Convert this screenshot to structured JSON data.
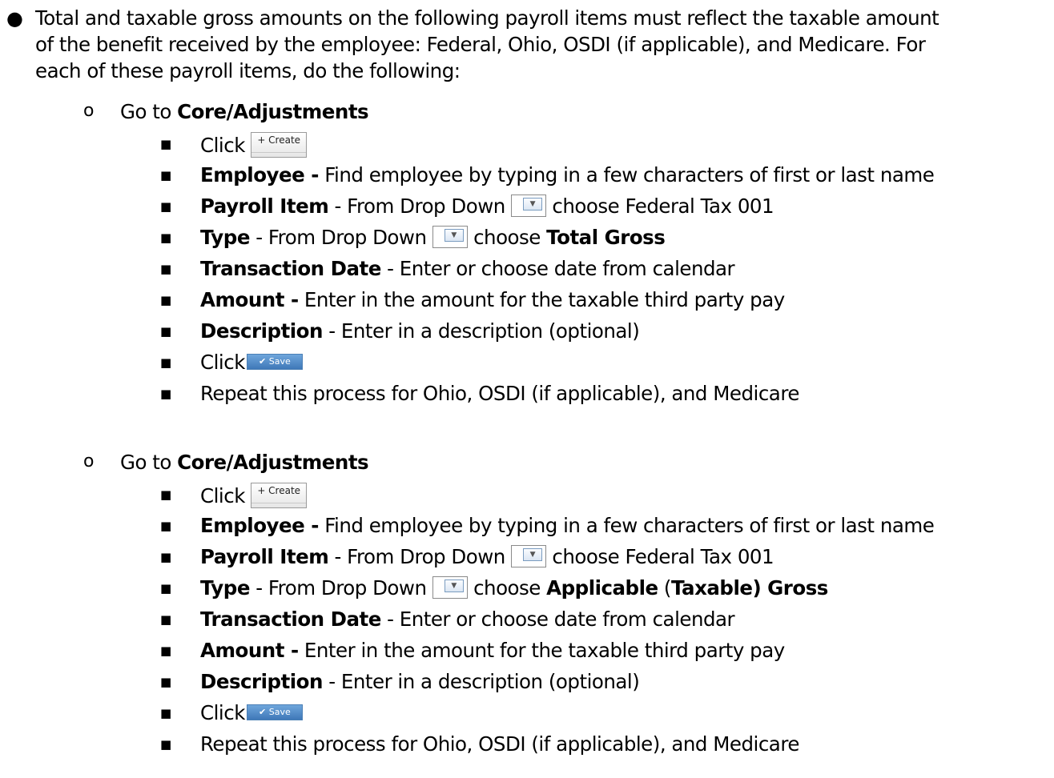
{
  "intro": {
    "line1": "Total and taxable gross amounts on the following payroll items must reflect the taxable amount",
    "line2": "of the benefit received by the employee: Federal, Ohio, OSDI (if applicable), and Medicare. For",
    "line3": "each of these payroll items, do the following:"
  },
  "sections": [
    {
      "goto_prefix": "Go to ",
      "goto_bold": "Core/Adjustments",
      "click1": "Click",
      "create_label": "+ Create",
      "employee_label": "Employee -",
      "employee_text": " Find employee by typing in a few characters of first or last name",
      "payroll_label": "Payroll Item",
      "payroll_prefix": " - From Drop Down ",
      "payroll_suffix": " choose Federal Tax 001",
      "type_label": "Type",
      "type_prefix": " - From Drop Down ",
      "type_mid": " choose ",
      "type_choice_bold_1": "Total Gross",
      "type_choice_plain": "",
      "type_choice_bold_2": "",
      "tdate_label": "Transaction Date",
      "tdate_text": " - Enter or choose date from calendar",
      "amount_label": "Amount -",
      "amount_text": " Enter in the amount for the taxable third party pay",
      "desc_label": "Description",
      "desc_text": " - Enter in a description (optional)",
      "click2": "Click",
      "save_label": "✔ Save",
      "repeat_text": "Repeat this process for Ohio, OSDI (if applicable), and Medicare"
    },
    {
      "goto_prefix": "Go to ",
      "goto_bold": "Core/Adjustments",
      "click1": "Click",
      "create_label": "+ Create",
      "employee_label": "Employee -",
      "employee_text": " Find employee by typing in a few characters of first or last name",
      "payroll_label": "Payroll Item",
      "payroll_prefix": " - From Drop Down ",
      "payroll_suffix": " choose Federal Tax 001",
      "type_label": "Type",
      "type_prefix": " - From Drop Down ",
      "type_mid": " choose ",
      "type_choice_bold_1": "Applicable",
      "type_choice_plain": " (",
      "type_choice_bold_2": "Taxable) Gross",
      "tdate_label": "Transaction Date",
      "tdate_text": " - Enter or choose date from calendar",
      "amount_label": "Amount -",
      "amount_text": " Enter in the amount for the taxable third party pay",
      "desc_label": "Description",
      "desc_text": " - Enter in a description (optional)",
      "click2": "Click",
      "save_label": "✔ Save",
      "repeat_text": "Repeat this process for Ohio, OSDI (if applicable), and Medicare"
    }
  ],
  "markers": {
    "level1": "●",
    "level2": "o",
    "level3": "■"
  },
  "icons": {
    "dropdown": "chevron-down-icon"
  },
  "colors": {
    "save_button": "#3f78b8",
    "text": "#000000"
  }
}
